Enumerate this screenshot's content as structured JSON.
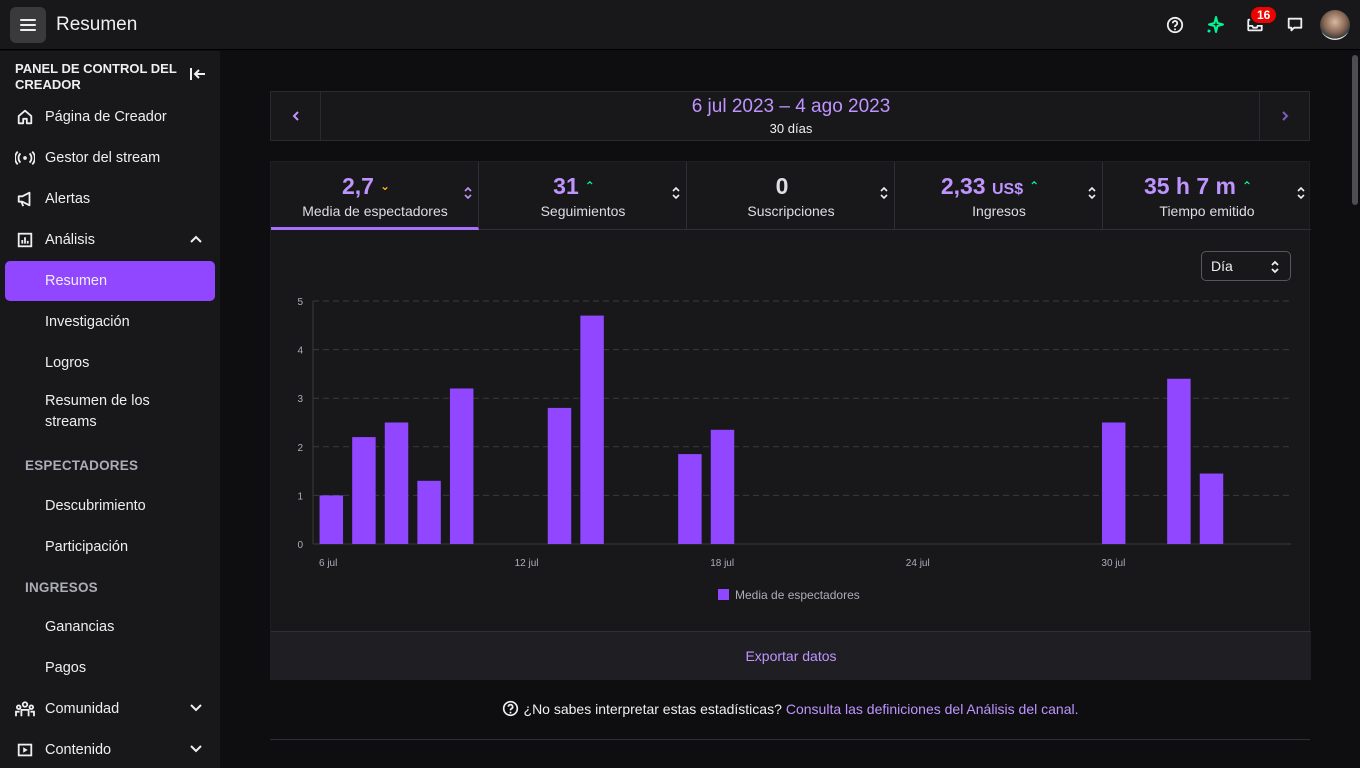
{
  "topbar": {
    "title": "Resumen",
    "notifications_count": "16"
  },
  "sidebar": {
    "header": "PANEL DE CONTROL DEL CREADOR",
    "items": {
      "creator_page": "Página de Creador",
      "stream_manager": "Gestor del stream",
      "alerts": "Alertas",
      "analytics": "Análisis",
      "summary": "Resumen",
      "research": "Investigación",
      "achievements": "Logros",
      "stream_summary": "Resumen de los streams",
      "discovery": "Descubrimiento",
      "participation": "Participación",
      "earnings": "Ganancias",
      "payments": "Pagos",
      "community": "Comunidad",
      "content": "Contenido"
    },
    "sections": {
      "viewers": "ESPECTADORES",
      "revenue": "INGRESOS"
    }
  },
  "date_bar": {
    "range": "6 jul 2023 – 4 ago 2023",
    "days": "30 días"
  },
  "metrics": [
    {
      "value": "2,7",
      "unit": "",
      "trend": "down",
      "label": "Media de espectadores"
    },
    {
      "value": "31",
      "unit": "",
      "trend": "up",
      "label": "Seguimientos"
    },
    {
      "value": "0",
      "unit": "",
      "trend": "",
      "label": "Suscripciones"
    },
    {
      "value": "2,33",
      "unit": "US$",
      "trend": "up",
      "label": "Ingresos"
    },
    {
      "value": "35 h 7 m",
      "unit": "",
      "trend": "up",
      "label": "Tiempo emitido"
    }
  ],
  "granularity": "Día",
  "colors": {
    "accent": "#9147ff",
    "accent_text": "#bf94ff",
    "trend_up": "#00f593",
    "trend_down": "#ffb31a"
  },
  "chart_data": {
    "type": "bar",
    "x": [
      "6 jul",
      "7 jul",
      "8 jul",
      "9 jul",
      "10 jul",
      "11 jul",
      "12 jul",
      "13 jul",
      "14 jul",
      "15 jul",
      "16 jul",
      "17 jul",
      "18 jul",
      "19 jul",
      "20 jul",
      "21 jul",
      "22 jul",
      "23 jul",
      "24 jul",
      "25 jul",
      "26 jul",
      "27 jul",
      "28 jul",
      "29 jul",
      "30 jul",
      "31 jul",
      "1 ago",
      "2 ago",
      "3 ago",
      "4 ago"
    ],
    "series": [
      {
        "name": "Media de espectadores",
        "values": [
          1.0,
          2.2,
          2.5,
          1.3,
          3.2,
          0,
          0,
          2.8,
          4.7,
          0,
          0,
          1.85,
          2.35,
          0,
          0,
          0,
          0,
          0,
          0,
          0,
          0,
          0,
          0,
          0,
          2.5,
          0,
          3.4,
          1.45,
          0,
          0
        ]
      }
    ],
    "xticks": [
      "6 jul",
      "12 jul",
      "18 jul",
      "24 jul",
      "30 jul"
    ],
    "yticks": [
      "0",
      "1",
      "2",
      "3",
      "4",
      "5"
    ],
    "ylim": [
      0,
      5
    ],
    "grid": true,
    "legend": "bottom-center"
  },
  "export_label": "Exportar datos",
  "help": {
    "question": "¿No sabes interpretar estas estadísticas?",
    "link": "Consulta las definiciones del Análisis del canal."
  }
}
